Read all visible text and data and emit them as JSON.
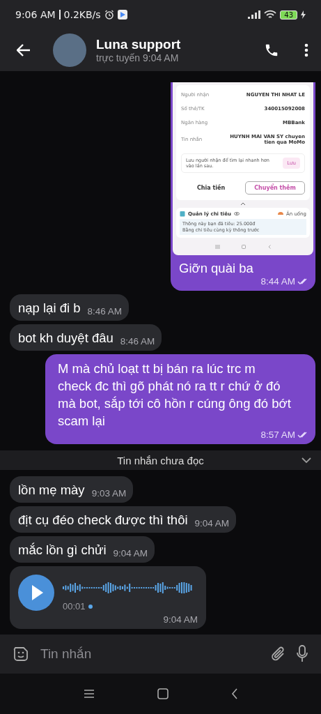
{
  "status_bar": {
    "time": "9:06 AM",
    "speed": "0.2KB/s",
    "battery": "43"
  },
  "header": {
    "title": "Luna support",
    "status": "trực tuyến 9:04 AM"
  },
  "messages": [
    {
      "kind": "image",
      "outgoing": true,
      "read": true,
      "caption": "Giỡn quài ba",
      "time": "8:44 AM",
      "receipt": {
        "rows": [
          {
            "label": "Người nhận",
            "value": "NGUYEN THI NHAT LE"
          },
          {
            "label": "Số thẻ/TK",
            "value": "340015092008"
          },
          {
            "label": "Ngân hàng",
            "value": "MBBank"
          },
          {
            "label": "Tin nhắn",
            "value": "HUYNH MAI VAN SY chuyen tien qua MoMo"
          }
        ],
        "save_hint": "Lưu người nhận để tìm lại nhanh hơn vào lần sau.",
        "save_button": "Lưu",
        "buttons": [
          {
            "label": "Chia tiền",
            "selected": false
          },
          {
            "label": "Chuyển thêm",
            "selected": true
          }
        ],
        "expense_title": "Quản lý chi tiêu",
        "expense_category": "Ăn uống",
        "expense_lines": [
          "Thông này bạn đã tiêu: 25.000đ",
          "Bằng chi tiêu cùng kỳ thông trước"
        ]
      }
    },
    {
      "kind": "text",
      "outgoing": false,
      "text": "nạp lại đi b",
      "time": "8:46 AM"
    },
    {
      "kind": "text",
      "outgoing": false,
      "text": "bot kh duyệt đâu",
      "time": "8:46 AM"
    },
    {
      "kind": "text",
      "outgoing": true,
      "read": true,
      "text": "M mà chủ loạt tt bị bán ra lúc trc m check đc thì gõ phát nó ra tt r chứ ở đó mà bot, sắp tới cô hồn r cúng ông đó bớt scam lại",
      "time": "8:57 AM"
    },
    {
      "kind": "divider",
      "text": "Tin nhắn chưa đọc"
    },
    {
      "kind": "text",
      "outgoing": false,
      "text": "lồn mẹ mày",
      "time": "9:03 AM"
    },
    {
      "kind": "text",
      "outgoing": false,
      "text": "địt cụ đéo check được thì thôi",
      "time": "9:04 AM"
    },
    {
      "kind": "text",
      "outgoing": false,
      "text": "mắc lồn gì chửi",
      "time": "9:04 AM"
    },
    {
      "kind": "voice",
      "outgoing": false,
      "duration": "00:01",
      "listened": false,
      "time": "9:04 AM"
    }
  ],
  "composer": {
    "placeholder": "Tin nhắn"
  }
}
